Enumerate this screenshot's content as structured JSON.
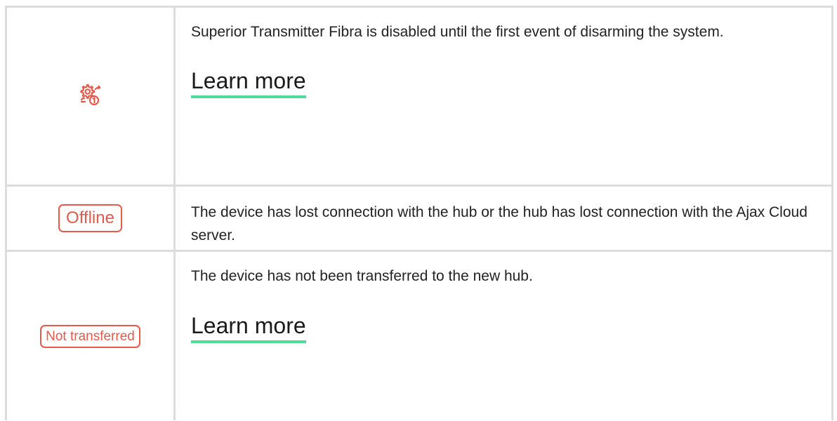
{
  "rows": [
    {
      "icon": "gear-clock-number-icon",
      "icon_color": "#e8594a",
      "description": "Superior Transmitter Fibra is disabled until the first event of disarming the system.",
      "link_label": "Learn more"
    },
    {
      "badge": "Offline",
      "badge_color": "#e8594a",
      "description": "The device has lost connection with the hub or the hub has lost connection with the Ajax Cloud server."
    },
    {
      "badge": "Not transferred",
      "badge_color": "#e8594a",
      "description": "The device has not been transferred to the new hub.",
      "link_label": "Learn more"
    }
  ],
  "link_underline_color": "#4fdc9a"
}
